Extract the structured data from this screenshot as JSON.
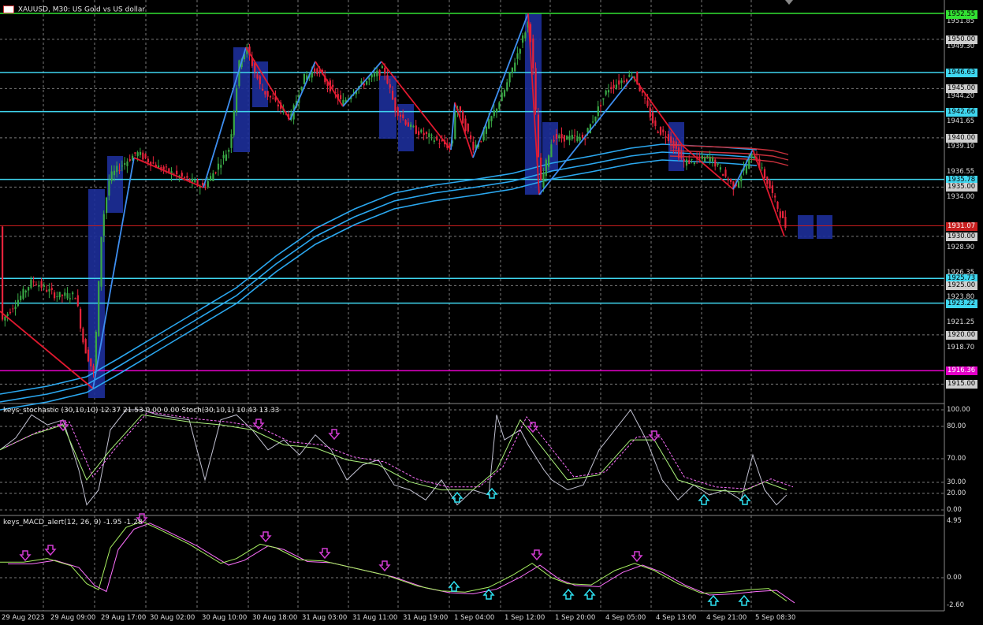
{
  "header": {
    "symbol_line": "XAUUSD, M30:  US Gold vs US dollar",
    "stoch_line": "keys_stochastic (30,10,10) 12.37 21.53 0.00 0.00 Stoch(30,10,1) 10.43 13.33",
    "macd_line": "keys_MACD_alert(12, 26, 9) -1.95 -1.28"
  },
  "colors": {
    "background": "#000000",
    "grid": "#7a7a7a",
    "bull_candle": "#39a845",
    "bear_candle": "#e6233b",
    "cyan_level": "#3fd6ef",
    "green_level": "#33e133",
    "magenta_level": "#e400c8",
    "red_level": "#c81e1e",
    "zigzag_up": "#3e8ef0",
    "zigzag_down": "#e0192f",
    "ma_blue": "#2ba8f0",
    "ma_red": "#c8303c",
    "box_blue": "#1d2f9a",
    "stoch_main": "#c0c0d0",
    "stoch_signal": "#aaf07a",
    "macd_main": "#a8f060",
    "macd_signal": "#ff70ff",
    "arrow_down": "#d23cd2",
    "arrow_up": "#2ee0f0"
  },
  "price_axis": {
    "ticks": [
      "1951.85",
      "1949.30",
      "1944.20",
      "1941.65",
      "1939.10",
      "1936.55",
      "1934.00",
      "1928.90",
      "1926.35",
      "1923.80",
      "1921.25",
      "1918.70"
    ],
    "boxes": [
      {
        "text": "1952.55",
        "bg": "#33e133",
        "fg": "#000000"
      },
      {
        "text": "1950.00",
        "bg": "#cfcfcf",
        "fg": "#000000"
      },
      {
        "text": "1946.63",
        "bg": "#3fd6ef",
        "fg": "#000000"
      },
      {
        "text": "1945.00",
        "bg": "#cfcfcf",
        "fg": "#000000"
      },
      {
        "text": "1942.66",
        "bg": "#3fd6ef",
        "fg": "#000000"
      },
      {
        "text": "1940.00",
        "bg": "#cfcfcf",
        "fg": "#000000"
      },
      {
        "text": "1935.78",
        "bg": "#3fd6ef",
        "fg": "#000000"
      },
      {
        "text": "1935.00",
        "bg": "#cfcfcf",
        "fg": "#000000"
      },
      {
        "text": "1931.07",
        "bg": "#c81e1e",
        "fg": "#ffffff"
      },
      {
        "text": "1930.00",
        "bg": "#cfcfcf",
        "fg": "#000000"
      },
      {
        "text": "1925.73",
        "bg": "#3fd6ef",
        "fg": "#000000"
      },
      {
        "text": "1925.00",
        "bg": "#cfcfcf",
        "fg": "#000000"
      },
      {
        "text": "1923.22",
        "bg": "#3fd6ef",
        "fg": "#000000"
      },
      {
        "text": "1920.00",
        "bg": "#cfcfcf",
        "fg": "#000000"
      },
      {
        "text": "1916.36",
        "bg": "#e400c8",
        "fg": "#ffffff"
      },
      {
        "text": "1915.00",
        "bg": "#cfcfcf",
        "fg": "#000000"
      }
    ]
  },
  "stoch_axis": [
    "100.00",
    "80.00",
    "70.00",
    "30.00",
    "20.00",
    "0.00"
  ],
  "macd_axis": [
    "4.95",
    "0.00",
    "-2.60"
  ],
  "time_axis": [
    "29 Aug 2023",
    "29 Aug 09:00",
    "29 Aug 17:00",
    "30 Aug 02:00",
    "30 Aug 10:00",
    "30 Aug 18:00",
    "31 Aug 03:00",
    "31 Aug 11:00",
    "31 Aug 19:00",
    "1 Sep 04:00",
    "1 Sep 12:00",
    "1 Sep 20:00",
    "4 Sep 05:00",
    "4 Sep 13:00",
    "4 Sep 21:00",
    "5 Sep 08:30"
  ]
}
